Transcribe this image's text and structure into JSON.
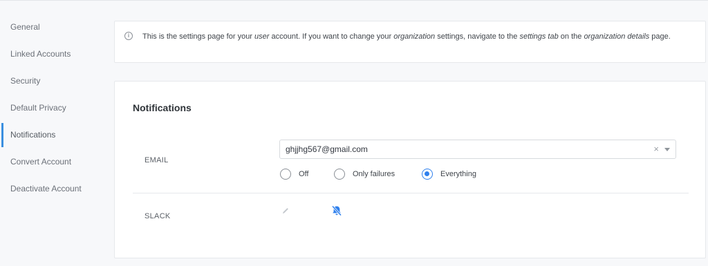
{
  "sidebar": {
    "items": [
      {
        "label": "General"
      },
      {
        "label": "Linked Accounts"
      },
      {
        "label": "Security"
      },
      {
        "label": "Default Privacy"
      },
      {
        "label": "Notifications",
        "active": true
      },
      {
        "label": "Convert Account"
      },
      {
        "label": "Deactivate Account"
      }
    ]
  },
  "info": {
    "icon": "info-icon",
    "t1": "This is the settings page for your ",
    "em1": "user",
    "t2": " account. If you want to change your ",
    "em2": "organization",
    "t3": " settings, navigate to the ",
    "em3": "settings tab",
    "t4": " on the ",
    "em4": "organization details",
    "t5": " page."
  },
  "notifications": {
    "title": "Notifications",
    "email": {
      "label": "EMAIL",
      "value": "ghjjhg567@gmail.com",
      "clear": "×",
      "options": [
        {
          "label": "Off",
          "checked": false
        },
        {
          "label": "Only failures",
          "checked": false
        },
        {
          "label": "Everything",
          "checked": true
        }
      ]
    },
    "slack": {
      "label": "SLACK",
      "edit_icon": "pencil-icon",
      "mute_icon": "bell-slash-icon"
    }
  },
  "colors": {
    "accent": "#2f80ed",
    "sidebar_indicator": "#3b8fe0"
  }
}
